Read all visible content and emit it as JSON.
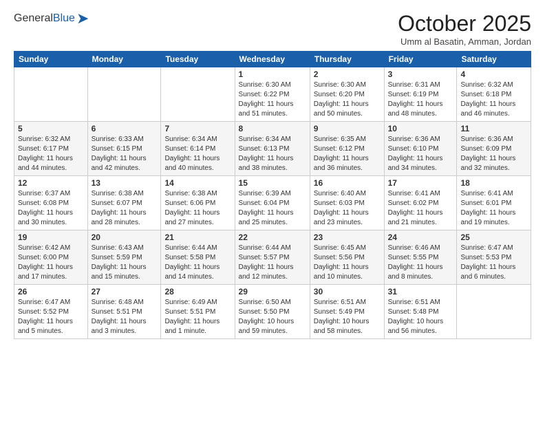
{
  "header": {
    "logo_general": "General",
    "logo_blue": "Blue",
    "month": "October 2025",
    "location": "Umm al Basatin, Amman, Jordan"
  },
  "weekdays": [
    "Sunday",
    "Monday",
    "Tuesday",
    "Wednesday",
    "Thursday",
    "Friday",
    "Saturday"
  ],
  "weeks": [
    [
      {
        "day": "",
        "info": ""
      },
      {
        "day": "",
        "info": ""
      },
      {
        "day": "",
        "info": ""
      },
      {
        "day": "1",
        "info": "Sunrise: 6:30 AM\nSunset: 6:22 PM\nDaylight: 11 hours\nand 51 minutes."
      },
      {
        "day": "2",
        "info": "Sunrise: 6:30 AM\nSunset: 6:20 PM\nDaylight: 11 hours\nand 50 minutes."
      },
      {
        "day": "3",
        "info": "Sunrise: 6:31 AM\nSunset: 6:19 PM\nDaylight: 11 hours\nand 48 minutes."
      },
      {
        "day": "4",
        "info": "Sunrise: 6:32 AM\nSunset: 6:18 PM\nDaylight: 11 hours\nand 46 minutes."
      }
    ],
    [
      {
        "day": "5",
        "info": "Sunrise: 6:32 AM\nSunset: 6:17 PM\nDaylight: 11 hours\nand 44 minutes."
      },
      {
        "day": "6",
        "info": "Sunrise: 6:33 AM\nSunset: 6:15 PM\nDaylight: 11 hours\nand 42 minutes."
      },
      {
        "day": "7",
        "info": "Sunrise: 6:34 AM\nSunset: 6:14 PM\nDaylight: 11 hours\nand 40 minutes."
      },
      {
        "day": "8",
        "info": "Sunrise: 6:34 AM\nSunset: 6:13 PM\nDaylight: 11 hours\nand 38 minutes."
      },
      {
        "day": "9",
        "info": "Sunrise: 6:35 AM\nSunset: 6:12 PM\nDaylight: 11 hours\nand 36 minutes."
      },
      {
        "day": "10",
        "info": "Sunrise: 6:36 AM\nSunset: 6:10 PM\nDaylight: 11 hours\nand 34 minutes."
      },
      {
        "day": "11",
        "info": "Sunrise: 6:36 AM\nSunset: 6:09 PM\nDaylight: 11 hours\nand 32 minutes."
      }
    ],
    [
      {
        "day": "12",
        "info": "Sunrise: 6:37 AM\nSunset: 6:08 PM\nDaylight: 11 hours\nand 30 minutes."
      },
      {
        "day": "13",
        "info": "Sunrise: 6:38 AM\nSunset: 6:07 PM\nDaylight: 11 hours\nand 28 minutes."
      },
      {
        "day": "14",
        "info": "Sunrise: 6:38 AM\nSunset: 6:06 PM\nDaylight: 11 hours\nand 27 minutes."
      },
      {
        "day": "15",
        "info": "Sunrise: 6:39 AM\nSunset: 6:04 PM\nDaylight: 11 hours\nand 25 minutes."
      },
      {
        "day": "16",
        "info": "Sunrise: 6:40 AM\nSunset: 6:03 PM\nDaylight: 11 hours\nand 23 minutes."
      },
      {
        "day": "17",
        "info": "Sunrise: 6:41 AM\nSunset: 6:02 PM\nDaylight: 11 hours\nand 21 minutes."
      },
      {
        "day": "18",
        "info": "Sunrise: 6:41 AM\nSunset: 6:01 PM\nDaylight: 11 hours\nand 19 minutes."
      }
    ],
    [
      {
        "day": "19",
        "info": "Sunrise: 6:42 AM\nSunset: 6:00 PM\nDaylight: 11 hours\nand 17 minutes."
      },
      {
        "day": "20",
        "info": "Sunrise: 6:43 AM\nSunset: 5:59 PM\nDaylight: 11 hours\nand 15 minutes."
      },
      {
        "day": "21",
        "info": "Sunrise: 6:44 AM\nSunset: 5:58 PM\nDaylight: 11 hours\nand 14 minutes."
      },
      {
        "day": "22",
        "info": "Sunrise: 6:44 AM\nSunset: 5:57 PM\nDaylight: 11 hours\nand 12 minutes."
      },
      {
        "day": "23",
        "info": "Sunrise: 6:45 AM\nSunset: 5:56 PM\nDaylight: 11 hours\nand 10 minutes."
      },
      {
        "day": "24",
        "info": "Sunrise: 6:46 AM\nSunset: 5:55 PM\nDaylight: 11 hours\nand 8 minutes."
      },
      {
        "day": "25",
        "info": "Sunrise: 6:47 AM\nSunset: 5:53 PM\nDaylight: 11 hours\nand 6 minutes."
      }
    ],
    [
      {
        "day": "26",
        "info": "Sunrise: 6:47 AM\nSunset: 5:52 PM\nDaylight: 11 hours\nand 5 minutes."
      },
      {
        "day": "27",
        "info": "Sunrise: 6:48 AM\nSunset: 5:51 PM\nDaylight: 11 hours\nand 3 minutes."
      },
      {
        "day": "28",
        "info": "Sunrise: 6:49 AM\nSunset: 5:51 PM\nDaylight: 11 hours\nand 1 minute."
      },
      {
        "day": "29",
        "info": "Sunrise: 6:50 AM\nSunset: 5:50 PM\nDaylight: 10 hours\nand 59 minutes."
      },
      {
        "day": "30",
        "info": "Sunrise: 6:51 AM\nSunset: 5:49 PM\nDaylight: 10 hours\nand 58 minutes."
      },
      {
        "day": "31",
        "info": "Sunrise: 6:51 AM\nSunset: 5:48 PM\nDaylight: 10 hours\nand 56 minutes."
      },
      {
        "day": "",
        "info": ""
      }
    ]
  ]
}
